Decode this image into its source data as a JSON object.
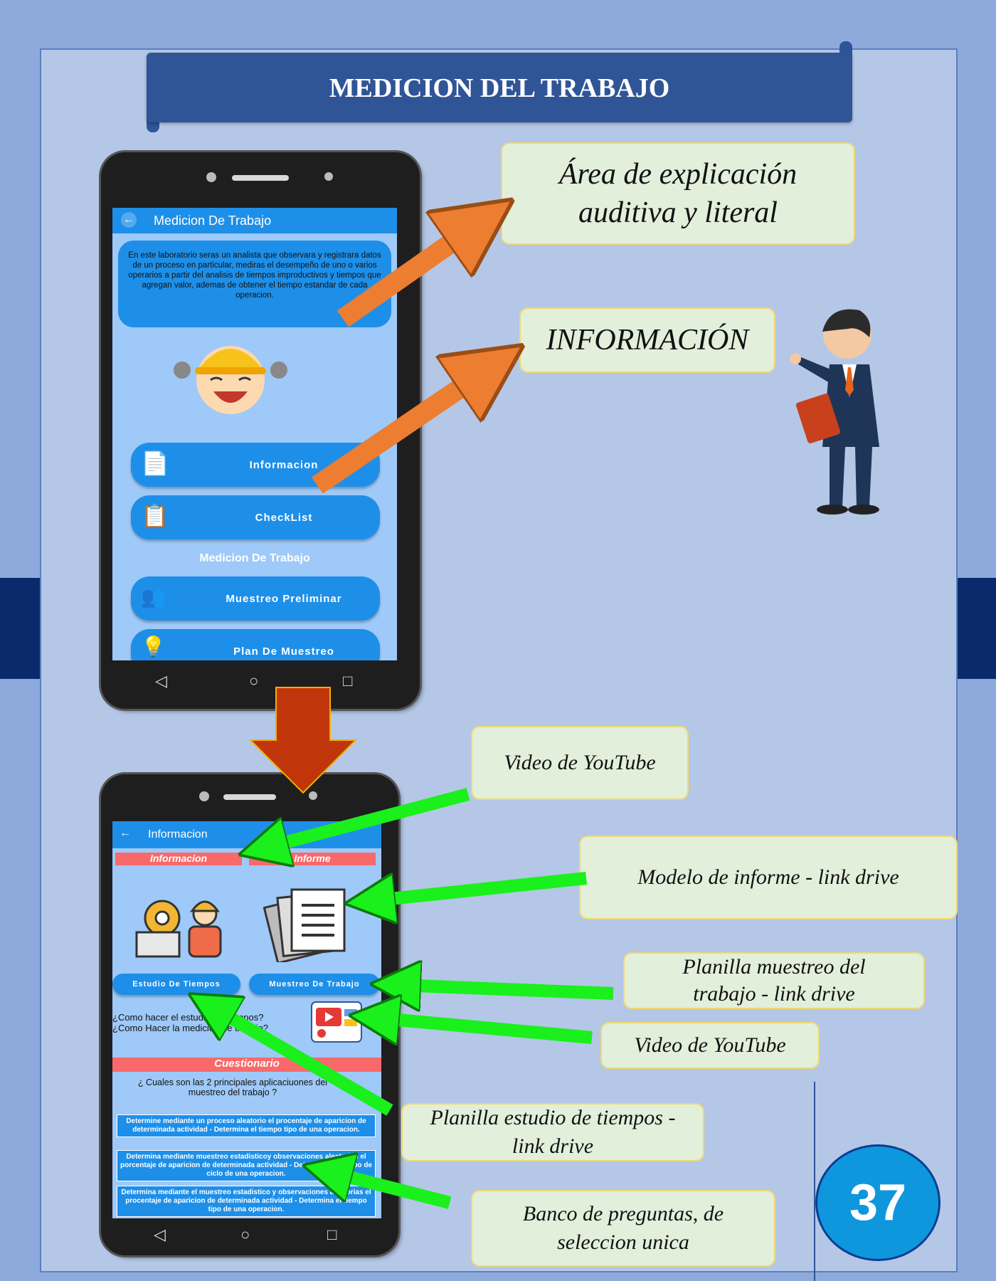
{
  "page": {
    "title": "MEDICION DEL TRABAJO",
    "page_number": "37",
    "colors": {
      "background": "#8eaadc",
      "panel": "#b4c7e7",
      "banner": "#2f5597",
      "callout_bg": "#e2efda",
      "app_blue": "#1e8fe8",
      "arrow_orange": "#ed7d31",
      "arrow_red": "#c0360a",
      "arrow_green": "#19f01c"
    }
  },
  "callouts": {
    "area": [
      "Área de explicación",
      "auditiva y literal"
    ],
    "informacion": "INFORMACIÓN",
    "video1": "Video de YouTube",
    "modelo": "Modelo de informe  - link drive",
    "planilla_muestreo": [
      "Planilla muestreo del",
      "trabajo - link drive"
    ],
    "video2": "Video de YouTube",
    "planilla_tiempos": [
      "Planilla estudio de tiempos -",
      "link drive"
    ],
    "banco": [
      "Banco de preguntas, de",
      "seleccion unica"
    ]
  },
  "phone1": {
    "appbar_title": "Medicion De Trabajo",
    "back_icon": "arrow-left-icon",
    "intro_text": "En este laboratorio seras un analista que observara y registrara datos de un proceso en particular, mediras el desempeño de uno o varios operarios a partir del analisis de tiempos improductivos y tiempos que agregan valor, ademas de obtener el tiempo estandar de cada operacion.",
    "buttons": [
      {
        "label": "Informacion",
        "icon": "document-info-icon"
      },
      {
        "label": "CheckList",
        "icon": "clipboard-icon"
      }
    ],
    "section_label": "Medicion De Trabajo",
    "buttons2": [
      {
        "label": "Muestreo Preliminar",
        "icon": "people-chart-icon"
      },
      {
        "label": "Plan De Muestreo",
        "icon": "lightbulb-chart-icon"
      }
    ]
  },
  "phone2": {
    "appbar_title": "Informacion",
    "tab_informacion": "Informacion",
    "tab_informe": "Informe",
    "btn_estudio": "Estudio De Tiempos",
    "btn_muestreo": "Muestreo De Trabajo",
    "question_line1": "¿Como hacer el estudio de tiempos?",
    "question_line2": "¿Como Hacer la medicion de trabajo?",
    "cuestionario": "Cuestionario",
    "quiz_question": "¿ Cuales son las 2 principales aplicaciuones del muestreo del trabajo ?",
    "answers": [
      "Determine mediante un proceso aleatorio el procentaje de aparicion de determinada actividad - Determina el tiempo tipo de una operacion.",
      "Determina mediante muestreo estadisticoy observaciones aleatorias el porcentaje de aparicion de determinada actividad - Determina el tiempo de ciclo de una operacion.",
      "Determina mediante el muestreo estadistico y observaciones aleatorias el procentaje de aparicion de determinada actividad - Determina el tiempo tipo de una operacion."
    ]
  },
  "nav_icons": [
    "back-triangle-icon",
    "home-circle-icon",
    "recents-square-icon"
  ]
}
